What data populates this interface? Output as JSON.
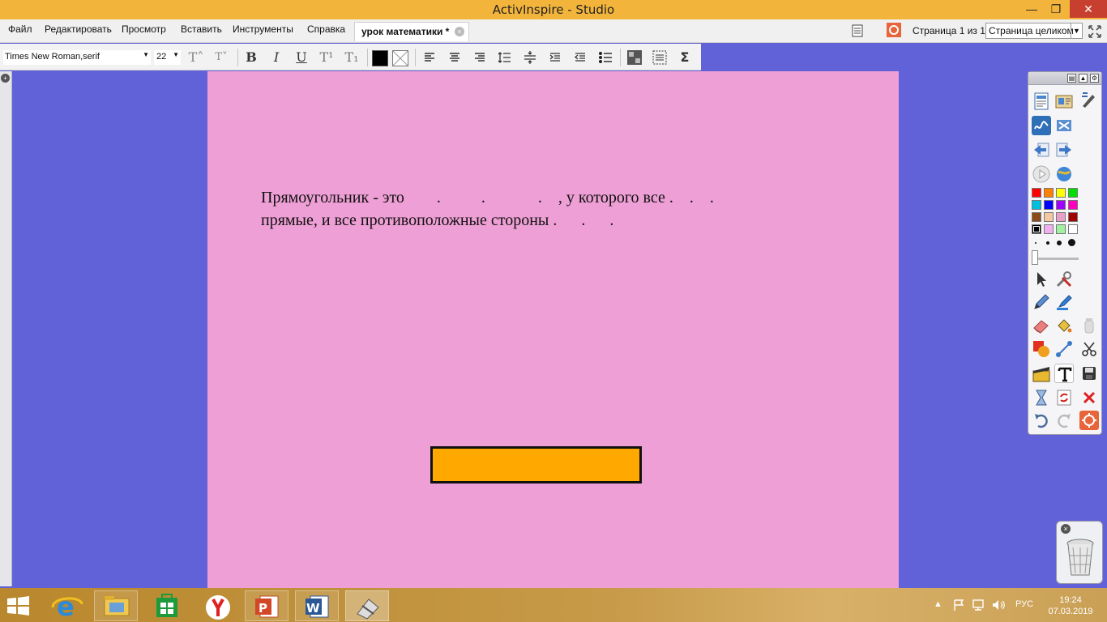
{
  "window": {
    "title": "ActivInspire - Studio",
    "minimize": "—",
    "restore": "❐",
    "close": "✕"
  },
  "menu": {
    "items": [
      "Файл",
      "Редактировать",
      "Просмотр",
      "Вставить",
      "Инструменты",
      "Справка"
    ],
    "doc_tab": "урок математики *",
    "doc_tab_close": "×",
    "page_count": "Страница 1 из 1",
    "zoom": "Страница целиком"
  },
  "format_toolbar": {
    "font": "Times New Roman,serif",
    "size": "22",
    "grow": "T˄",
    "shrink": "T˅",
    "bold": "B",
    "italic": "I",
    "underline": "U",
    "superscript": "T¹",
    "subscript": "T₁",
    "sigma": "Σ",
    "text_color": "#000000"
  },
  "canvas": {
    "background": "#ee9fd5",
    "line1": "Прямоугольник - это        .          .             .    , у которого все .    .    .",
    "line2": "прямые, и все противоположные стороны .      .      .",
    "shape_color": "#ffa800"
  },
  "palette": {
    "colors": [
      "#ff0000",
      "#ff8000",
      "#ffff00",
      "#00e000",
      "#00c0e0",
      "#0000ff",
      "#a000ff",
      "#ff00c0",
      "#8a4a1a",
      "#f4c8a0",
      "#e8a0c8",
      "#a00000",
      "#000000",
      "#f0b0f0",
      "#a0f0a0",
      "#ffffff"
    ]
  },
  "taskbar": {
    "language": "РУС",
    "time": "19:24",
    "date": "07.03.2019"
  }
}
